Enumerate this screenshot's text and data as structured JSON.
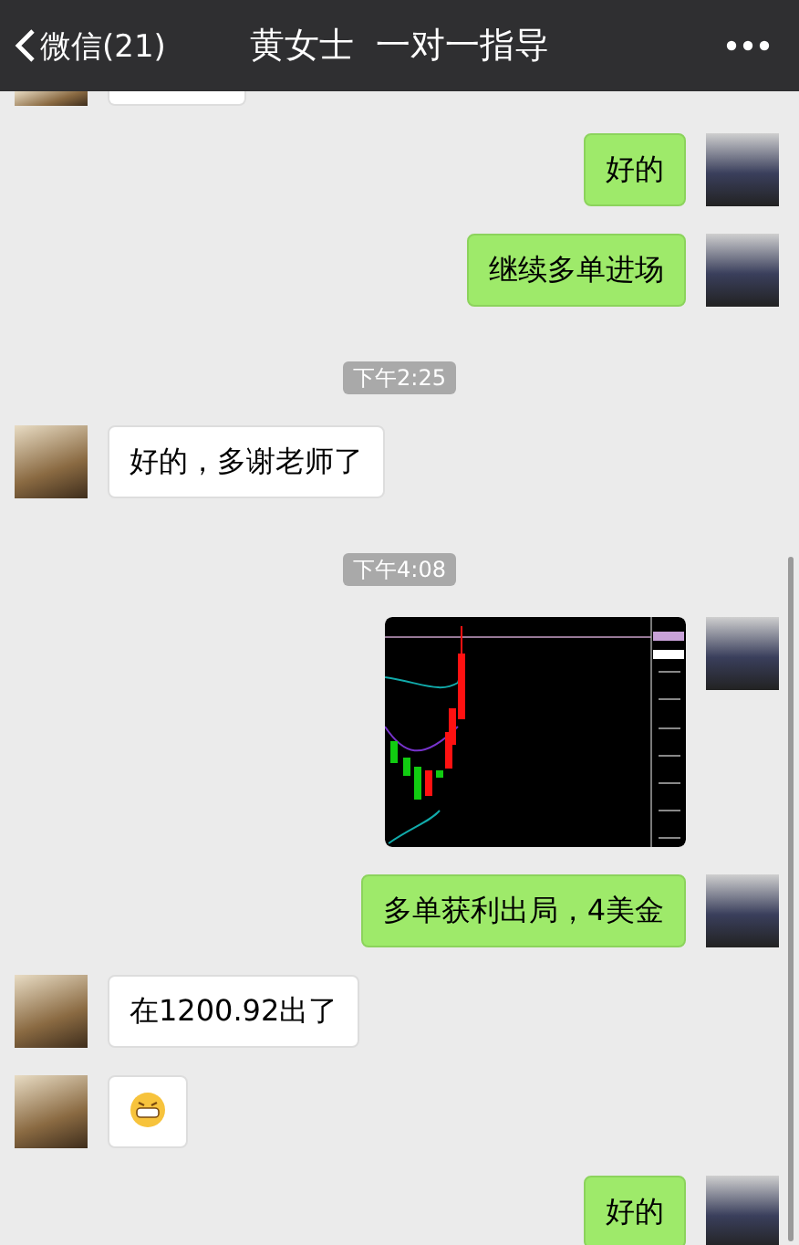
{
  "header": {
    "back_label": "微信(21)",
    "title": "黄女士  一对一指导"
  },
  "messages": [
    {
      "kind": "clipped",
      "outgoing": false
    },
    {
      "kind": "text",
      "outgoing": true,
      "text": "好的"
    },
    {
      "kind": "text",
      "outgoing": true,
      "text": "继续多单进场"
    },
    {
      "kind": "time",
      "text": "下午2:25"
    },
    {
      "kind": "text",
      "outgoing": false,
      "text": "好的，多谢老师了"
    },
    {
      "kind": "time",
      "text": "下午4:08"
    },
    {
      "kind": "image",
      "outgoing": true
    },
    {
      "kind": "text",
      "outgoing": true,
      "text": "多单获利出局，4美金"
    },
    {
      "kind": "text",
      "outgoing": false,
      "text": "在1200.92出了"
    },
    {
      "kind": "emoji",
      "outgoing": false
    },
    {
      "kind": "text",
      "outgoing": true,
      "text": "好的"
    }
  ]
}
